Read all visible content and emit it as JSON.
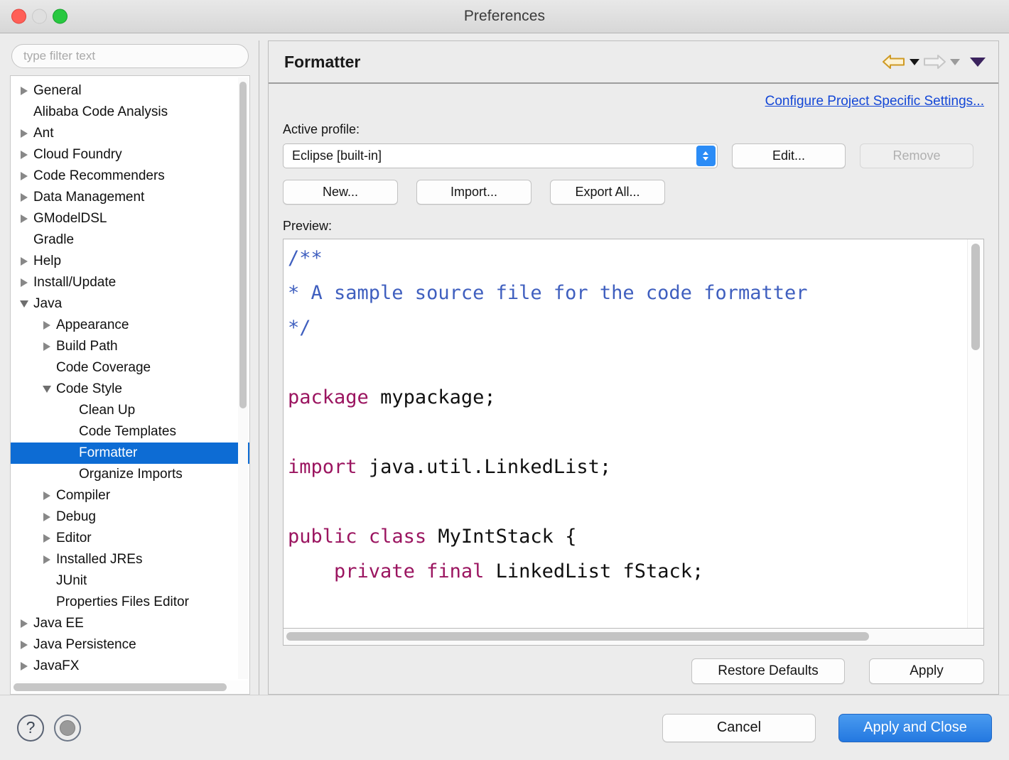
{
  "window": {
    "title": "Preferences",
    "traffic_lights": [
      "close",
      "minimize",
      "zoom"
    ]
  },
  "sidebar": {
    "filter": {
      "placeholder": "type filter text",
      "value": ""
    },
    "items": [
      {
        "label": "General",
        "indent": 0,
        "arrow": "collapsed"
      },
      {
        "label": "Alibaba Code Analysis",
        "indent": 0,
        "arrow": "none"
      },
      {
        "label": "Ant",
        "indent": 0,
        "arrow": "collapsed"
      },
      {
        "label": "Cloud Foundry",
        "indent": 0,
        "arrow": "collapsed"
      },
      {
        "label": "Code Recommenders",
        "indent": 0,
        "arrow": "collapsed"
      },
      {
        "label": "Data Management",
        "indent": 0,
        "arrow": "collapsed"
      },
      {
        "label": "GModelDSL",
        "indent": 0,
        "arrow": "collapsed"
      },
      {
        "label": "Gradle",
        "indent": 0,
        "arrow": "none"
      },
      {
        "label": "Help",
        "indent": 0,
        "arrow": "collapsed"
      },
      {
        "label": "Install/Update",
        "indent": 0,
        "arrow": "collapsed"
      },
      {
        "label": "Java",
        "indent": 0,
        "arrow": "expanded"
      },
      {
        "label": "Appearance",
        "indent": 1,
        "arrow": "collapsed"
      },
      {
        "label": "Build Path",
        "indent": 1,
        "arrow": "collapsed"
      },
      {
        "label": "Code Coverage",
        "indent": 1,
        "arrow": "none"
      },
      {
        "label": "Code Style",
        "indent": 1,
        "arrow": "expanded"
      },
      {
        "label": "Clean Up",
        "indent": 2,
        "arrow": "none"
      },
      {
        "label": "Code Templates",
        "indent": 2,
        "arrow": "none"
      },
      {
        "label": "Formatter",
        "indent": 2,
        "arrow": "none",
        "selected": true
      },
      {
        "label": "Organize Imports",
        "indent": 2,
        "arrow": "none"
      },
      {
        "label": "Compiler",
        "indent": 1,
        "arrow": "collapsed"
      },
      {
        "label": "Debug",
        "indent": 1,
        "arrow": "collapsed"
      },
      {
        "label": "Editor",
        "indent": 1,
        "arrow": "collapsed"
      },
      {
        "label": "Installed JREs",
        "indent": 1,
        "arrow": "collapsed"
      },
      {
        "label": "JUnit",
        "indent": 1,
        "arrow": "none"
      },
      {
        "label": "Properties Files Editor",
        "indent": 1,
        "arrow": "none"
      },
      {
        "label": "Java EE",
        "indent": 0,
        "arrow": "collapsed"
      },
      {
        "label": "Java Persistence",
        "indent": 0,
        "arrow": "collapsed"
      },
      {
        "label": "JavaFX",
        "indent": 0,
        "arrow": "collapsed"
      }
    ]
  },
  "page": {
    "title": "Formatter",
    "nav": {
      "back_icon": "back-arrow-icon",
      "back_menu_icon": "caret-down-icon",
      "forward_icon": "forward-arrow-icon",
      "forward_menu_icon": "caret-down-icon",
      "menu_icon": "caret-down-icon"
    },
    "configure_link": "Configure Project Specific Settings...",
    "active_profile_label": "Active profile:",
    "profile": {
      "selected": "Eclipse [built-in]",
      "options": [
        "Eclipse [built-in]"
      ]
    },
    "edit_button": "Edit...",
    "remove_button": "Remove",
    "remove_disabled": true,
    "new_button": "New...",
    "import_button": "Import...",
    "export_all_button": "Export All...",
    "preview_label": "Preview:",
    "preview_code": [
      {
        "text": "/**",
        "style": "doc"
      },
      {
        "text": "* A sample source file for the code formatter",
        "style": "doc"
      },
      {
        "text": "*/",
        "style": "doc"
      },
      {
        "text": "",
        "style": "plain"
      },
      {
        "text": "package mypackage;",
        "style": "kw-package"
      },
      {
        "text": "",
        "style": "plain"
      },
      {
        "text": "import java.util.LinkedList;",
        "style": "kw-import"
      },
      {
        "text": "",
        "style": "plain"
      },
      {
        "text": "public class MyIntStack {",
        "style": "kw-class"
      },
      {
        "text": "    private final LinkedList fStack;",
        "style": "kw-field"
      }
    ],
    "restore_defaults_button": "Restore Defaults",
    "apply_button": "Apply"
  },
  "footer": {
    "help_icon": "question-mark-icon",
    "secondary_icon": "disc-icon",
    "cancel_button": "Cancel",
    "apply_close_button": "Apply and Close"
  },
  "colors": {
    "selection_blue": "#0d6cd4",
    "link_blue": "#1447d6",
    "primary_button": "#2478e0",
    "javadoc": "#3f5fbf",
    "keyword": "#9b1560",
    "back_arrow_gold": "#d9a12c",
    "forward_arrow_gray": "#c6c6c6"
  }
}
